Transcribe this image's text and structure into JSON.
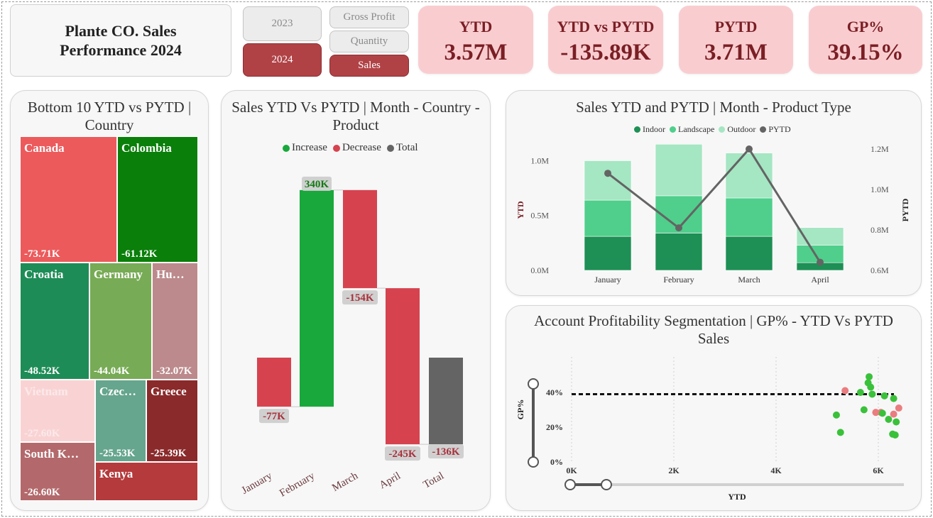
{
  "title": "Plante CO. Sales Performance 2024",
  "year_slicer": [
    "2023",
    "2024"
  ],
  "year_selected": "2024",
  "metric_slicer": [
    "Gross Profit",
    "Quantity",
    "Sales"
  ],
  "metric_selected": "Sales",
  "kpis": [
    {
      "label": "YTD",
      "value": "3.57M"
    },
    {
      "label": "YTD vs PYTD",
      "value": "-135.89K"
    },
    {
      "label": "PYTD",
      "value": "3.71M"
    },
    {
      "label": "GP%",
      "value": "39.15%"
    }
  ],
  "treemap": {
    "title": "Bottom 10 YTD vs PYTD | Country",
    "cells": [
      {
        "name": "Canada",
        "value": "-73.71K",
        "color": "#ec5a5c"
      },
      {
        "name": "Colombia",
        "value": "-61.12K",
        "color": "#0a7f0a"
      },
      {
        "name": "Croatia",
        "value": "-48.52K",
        "color": "#1e8c56"
      },
      {
        "name": "Germany",
        "value": "-44.04K",
        "color": "#77ab55"
      },
      {
        "name": "Hu…",
        "value": "-32.07K",
        "color": "#bc8a8c"
      },
      {
        "name": "Vietnam",
        "value": "-27.60K",
        "color": "#f9d3d4"
      },
      {
        "name": "Czec…",
        "value": "-25.53K",
        "color": "#66a58e"
      },
      {
        "name": "Greece",
        "value": "-25.39K",
        "color": "#8a2a2b"
      },
      {
        "name": "South K…",
        "value": "-26.60K",
        "color": "#b3696b"
      },
      {
        "name": "Kenya",
        "value": "",
        "color": "#b43a3c"
      }
    ]
  },
  "waterfall": {
    "title": "Sales YTD Vs PYTD | Month - Country - Product",
    "legend": [
      {
        "label": "Increase",
        "color": "#19a83c"
      },
      {
        "label": "Decrease",
        "color": "#d6434f"
      },
      {
        "label": "Total",
        "color": "#646464"
      }
    ]
  },
  "combo": {
    "title": "Sales YTD and PYTD | Month - Product Type",
    "legend": [
      {
        "label": "Indoor",
        "color": "#1e8f55"
      },
      {
        "label": "Landscape",
        "color": "#4fcf8b"
      },
      {
        "label": "Outdoor",
        "color": "#a5e6c3"
      },
      {
        "label": "PYTD",
        "color": "#646464"
      }
    ]
  },
  "scatter": {
    "title": "Account Profitability Segmentation | GP% - YTD Vs PYTD Sales"
  },
  "chart_data": [
    {
      "type": "bar",
      "subtype": "waterfall",
      "title": "Sales YTD Vs PYTD | Month - Country - Product",
      "categories": [
        "January",
        "February",
        "March",
        "April",
        "Total"
      ],
      "values": [
        -77,
        340,
        -154,
        -245,
        -136
      ],
      "labels": [
        "-77K",
        "340K",
        "-154K",
        "-245K",
        "-136K"
      ],
      "kinds": [
        "decrease",
        "increase",
        "decrease",
        "decrease",
        "total"
      ],
      "units": "K"
    },
    {
      "type": "bar",
      "subtype": "stacked-bar-with-line",
      "title": "Sales YTD and PYTD | Month - Product Type",
      "categories": [
        "January",
        "February",
        "March",
        "April"
      ],
      "ylabel": "YTD",
      "y2label": "PYTD",
      "ylim": [
        0,
        1.1
      ],
      "y2lim": [
        0.6,
        1.25
      ],
      "yticks": [
        "0.0M",
        "0.5M",
        "1.0M"
      ],
      "y2ticks": [
        "0.6M",
        "0.8M",
        "1.0M",
        "1.2M"
      ],
      "series": [
        {
          "name": "Indoor",
          "values": [
            0.31,
            0.34,
            0.31,
            0.07
          ],
          "color": "#1e8f55"
        },
        {
          "name": "Landscape",
          "values": [
            0.33,
            0.34,
            0.35,
            0.16
          ],
          "color": "#4fcf8b"
        },
        {
          "name": "Outdoor",
          "values": [
            0.36,
            0.47,
            0.41,
            0.16
          ],
          "color": "#a5e6c3"
        },
        {
          "name": "PYTD",
          "values": [
            1.08,
            0.81,
            1.2,
            0.64
          ],
          "color": "#646464",
          "axis": "secondary"
        }
      ]
    },
    {
      "type": "scatter",
      "title": "Account Profitability Segmentation | GP% - YTD Vs PYTD Sales",
      "xlabel": "YTD",
      "ylabel": "GP%",
      "xlim": [
        0,
        6.4
      ],
      "ylim": [
        0,
        0.5
      ],
      "xticks": [
        "0K",
        "2K",
        "4K",
        "6K"
      ],
      "yticks": [
        "0%",
        "20%",
        "40%"
      ],
      "reference_line": 0.39,
      "points": [
        {
          "x": 5.82,
          "y": 0.49,
          "c": "pos"
        },
        {
          "x": 5.8,
          "y": 0.455,
          "c": "pos"
        },
        {
          "x": 5.85,
          "y": 0.43,
          "c": "pos"
        },
        {
          "x": 5.35,
          "y": 0.41,
          "c": "neg"
        },
        {
          "x": 5.65,
          "y": 0.4,
          "c": "pos"
        },
        {
          "x": 5.88,
          "y": 0.39,
          "c": "pos"
        },
        {
          "x": 6.12,
          "y": 0.38,
          "c": "pos"
        },
        {
          "x": 6.3,
          "y": 0.365,
          "c": "pos"
        },
        {
          "x": 6.4,
          "y": 0.31,
          "c": "neg"
        },
        {
          "x": 5.72,
          "y": 0.3,
          "c": "pos"
        },
        {
          "x": 5.95,
          "y": 0.285,
          "c": "neg"
        },
        {
          "x": 6.05,
          "y": 0.285,
          "c": "neg"
        },
        {
          "x": 6.08,
          "y": 0.28,
          "c": "pos"
        },
        {
          "x": 6.3,
          "y": 0.275,
          "c": "neg"
        },
        {
          "x": 6.2,
          "y": 0.245,
          "c": "pos"
        },
        {
          "x": 5.18,
          "y": 0.27,
          "c": "pos"
        },
        {
          "x": 6.35,
          "y": 0.23,
          "c": "pos"
        },
        {
          "x": 5.26,
          "y": 0.17,
          "c": "pos"
        },
        {
          "x": 6.28,
          "y": 0.16,
          "c": "pos"
        },
        {
          "x": 6.33,
          "y": 0.155,
          "c": "pos"
        }
      ],
      "colors": {
        "pos": "#3ac13a",
        "neg": "#ea7d80"
      }
    }
  ]
}
